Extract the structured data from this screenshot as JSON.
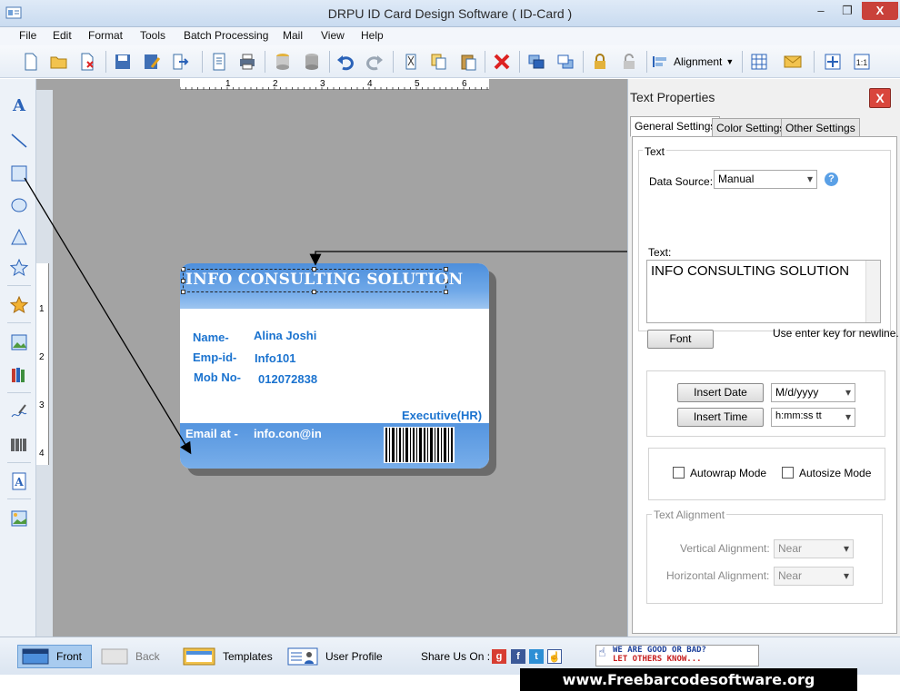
{
  "window": {
    "title": "DRPU ID Card Design Software ( ID-Card )",
    "min_glyph": "–",
    "max_glyph": "❐",
    "close_glyph": "X"
  },
  "menu": [
    "File",
    "Edit",
    "Format",
    "Tools",
    "Batch Processing",
    "Mail",
    "View",
    "Help"
  ],
  "toolbar": {
    "alignment_label": "Alignment"
  },
  "ruler": {
    "top_ticks": [
      "1",
      "2",
      "3",
      "4",
      "5",
      "6"
    ],
    "left_ticks": [
      "1",
      "2",
      "3",
      "4"
    ]
  },
  "card": {
    "title": "INFO CONSULTING SOLUTION",
    "name_label": "Name-",
    "name_value": "Alina Joshi",
    "empid_label": "Emp-id-",
    "empid_value": "Info101",
    "mob_label": "Mob No-",
    "mob_value": "012072838",
    "designation": "Executive(HR)",
    "email_label": "Email at -",
    "email_value": "info.con@in"
  },
  "properties": {
    "title": "Text Properties",
    "close_label": "X",
    "tabs": [
      "General Settings",
      "Color Settings",
      "Other Settings"
    ],
    "text_group": "Text",
    "data_source_label": "Data Source:",
    "data_source_value": "Manual",
    "help_glyph": "?",
    "text_label": "Text:",
    "text_value": "INFO CONSULTING SOLUTION",
    "font_button": "Font",
    "newline_hint": "Use enter key for newline.",
    "insert_date": "Insert Date",
    "date_format": "M/d/yyyy",
    "insert_time": "Insert Time",
    "time_format": "h:mm:ss tt",
    "autowrap": "Autowrap Mode",
    "autosize": "Autosize Mode",
    "alignment_group": "Text Alignment",
    "vertical_label": "Vertical Alignment:",
    "vertical_value": "Near",
    "horizontal_label": "Horizontal  Alignment:",
    "horizontal_value": "Near"
  },
  "bottom": {
    "front": "Front",
    "back": "Back",
    "templates": "Templates",
    "user_profile": "User Profile",
    "share_label": "Share Us On :",
    "promo_line1": "WE ARE GOOD OR BAD?",
    "promo_line2": "LET OTHERS KNOW...",
    "website": "www.Freebarcodesoftware.org"
  },
  "colors": {
    "card_blue": "#4d8fdc",
    "card_text_blue": "#1b73cf",
    "canvas_gray": "#a3a3a3",
    "close_red": "#d9463c"
  }
}
